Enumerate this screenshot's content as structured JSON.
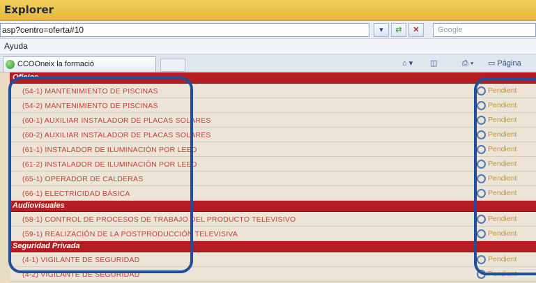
{
  "window": {
    "title": "Explorer"
  },
  "address": {
    "url": "asp?centro=oferta#10",
    "search_placeholder": "Google"
  },
  "menu": {
    "items": [
      "Ayuda"
    ]
  },
  "tabs": {
    "active_label": "CCOOneix la formació"
  },
  "toolbar": {
    "page_label": "Página"
  },
  "sections": [
    {
      "title": "Oficios",
      "courses": [
        {
          "name": "(54-1) MANTENIMIENTO DE PISCINAS",
          "status": "Pendient"
        },
        {
          "name": "(54-2) MANTENIMIENTO DE PISCINAS",
          "status": "Pendient"
        },
        {
          "name": "(60-1) AUXILIAR INSTALADOR DE PLACAS SOLARES",
          "status": "Pendient"
        },
        {
          "name": "(60-2) AUXILIAR INSTALADOR DE PLACAS SOLARES",
          "status": "Pendient"
        },
        {
          "name": "(61-1) INSTALADOR DE ILUMINACIÓN POR LEED",
          "status": "Pendient"
        },
        {
          "name": "(61-2) INSTALADOR DE ILUMINACIÓN POR LEED",
          "status": "Pendient"
        },
        {
          "name": "(65-1) OPERADOR DE CALDERAS",
          "status": "Pendient"
        },
        {
          "name": "(66-1) ELECTRICIDAD BÁSICA",
          "status": "Pendient"
        }
      ]
    },
    {
      "title": "Audiovisuales",
      "courses": [
        {
          "name": "(58-1) CONTROL DE PROCESOS DE TRABAJO DEL PRODUCTO TELEVISIVO",
          "status": "Pendient"
        },
        {
          "name": "(59-1) REALIZACIÓN DE LA POSTPRODUCCIÓN TELEVISIVA",
          "status": "Pendient"
        }
      ]
    },
    {
      "title": "Seguridad Privada",
      "courses": [
        {
          "name": "(4-1) VIGILANTE DE SEGURIDAD",
          "status": "Pendient"
        },
        {
          "name": "(4-2) VIGILANTE DE SEGURIDAD",
          "status": "Pendient"
        }
      ]
    }
  ],
  "colors": {
    "title_bar": "#f2cf5c",
    "section_header": "#b61d20",
    "course_text": "#c14336",
    "status_text": "#c8941f",
    "highlight_outline": "#1f4f9b"
  }
}
